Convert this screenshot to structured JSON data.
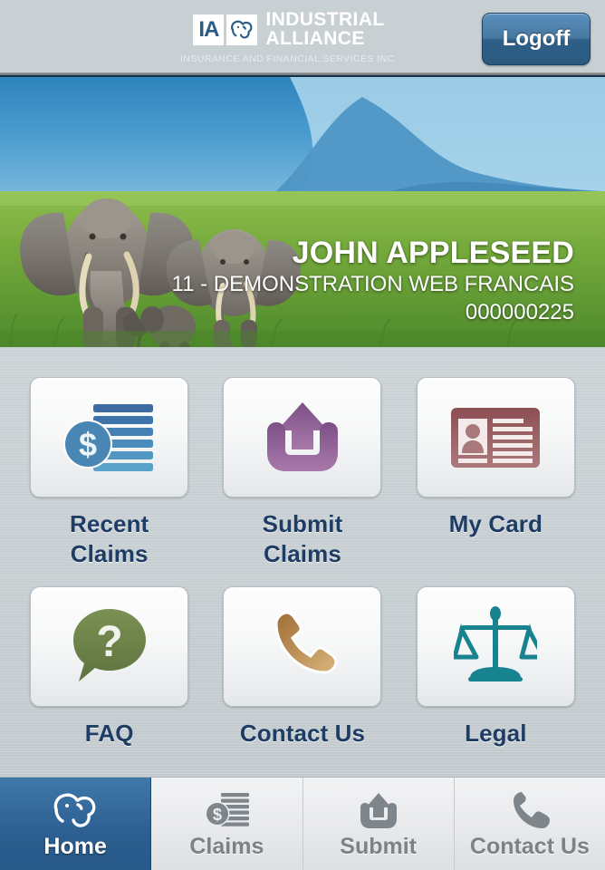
{
  "header": {
    "logo": {
      "mark_letters": "IA",
      "mark_icon": "elephant-icon",
      "line1": "INDUSTRIAL",
      "line2": "ALLIANCE",
      "tagline": "INSURANCE AND FINANCIAL SERVICES INC."
    },
    "logoff_label": "Logoff",
    "background_color": "#2a5a86"
  },
  "hero": {
    "image": "elephants-on-savanna-photo",
    "member_name": "JOHN APPLESEED",
    "group_name": "11 - DEMONSTRATION WEB FRANCAIS",
    "member_id": "000000225"
  },
  "main": {
    "tiles": [
      {
        "label": "Recent\nClaims",
        "label_line1": "Recent",
        "label_line2": "Claims",
        "icon": "coins-with-dollar-sign-icon",
        "icon_color": "#3c6fa4"
      },
      {
        "label": "Submit\nClaims",
        "label_line1": "Submit",
        "label_line2": "Claims",
        "icon": "upload-arrow-tray-icon",
        "icon_color": "#8e5f91"
      },
      {
        "label": "My Card",
        "label_line1": "My Card",
        "label_line2": "",
        "icon": "id-card-icon",
        "icon_color": "#8d5356"
      },
      {
        "label": "FAQ",
        "label_line1": "FAQ",
        "label_line2": "",
        "icon": "question-speech-bubble-icon",
        "icon_color": "#6c8047"
      },
      {
        "label": "Contact Us",
        "label_line1": "Contact Us",
        "label_line2": "",
        "icon": "telephone-handset-icon",
        "icon_color": "#b58b50"
      },
      {
        "label": "Legal",
        "label_line1": "Legal",
        "label_line2": "",
        "icon": "scales-of-justice-icon",
        "icon_color": "#17838f"
      }
    ],
    "label_color": "#1e3c64"
  },
  "tabbar": {
    "tabs": [
      {
        "label": "Home",
        "icon": "elephant-icon",
        "active": true
      },
      {
        "label": "Claims",
        "icon": "coins-with-dollar-sign-icon",
        "active": false
      },
      {
        "label": "Submit",
        "icon": "upload-arrow-tray-icon",
        "active": false
      },
      {
        "label": "Contact Us",
        "icon": "telephone-handset-icon",
        "active": false
      }
    ],
    "active_color": "#2a5c8d",
    "inactive_color": "#7c8288"
  }
}
